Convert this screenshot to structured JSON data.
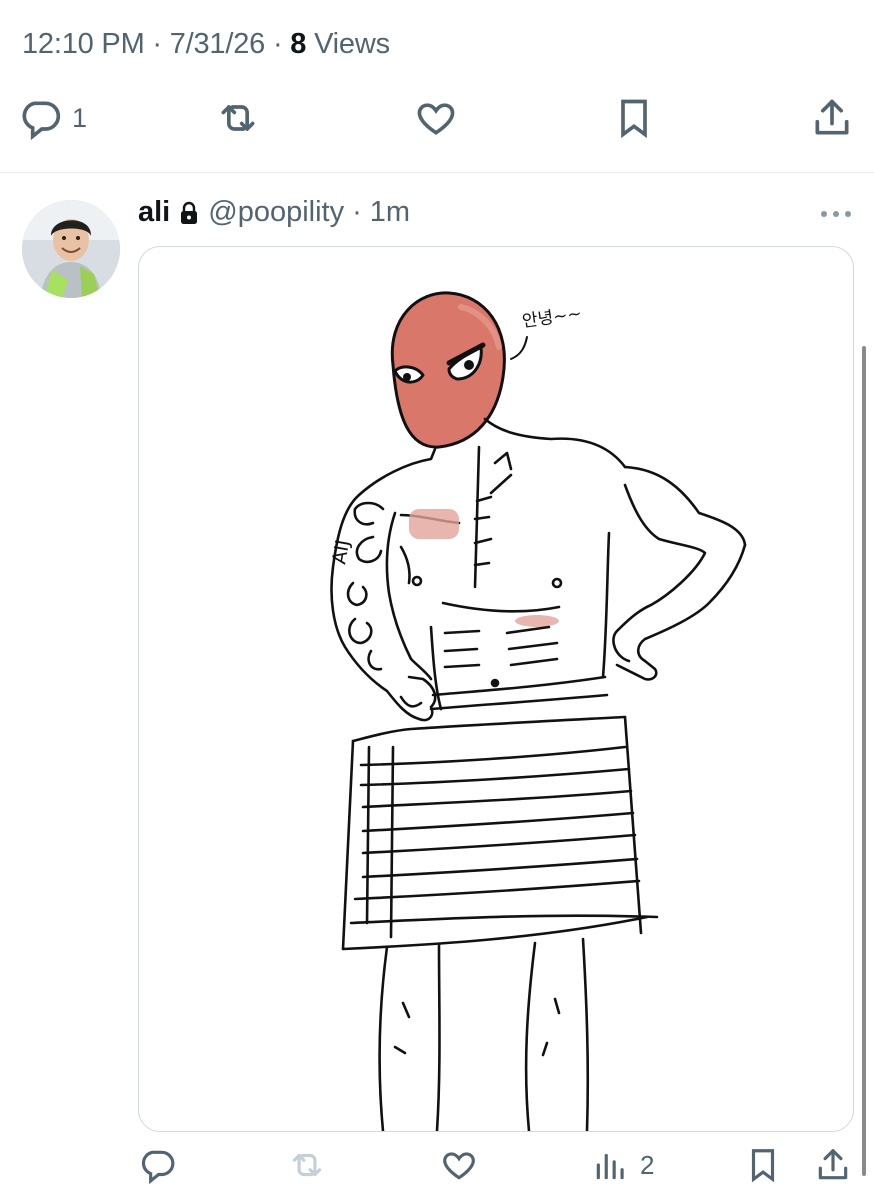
{
  "tweet": {
    "time": "12:10 PM",
    "date": "7/31/26",
    "views_count": "8",
    "views_label": "Views",
    "separator": "·"
  },
  "actions": {
    "reply_count": "1"
  },
  "reply": {
    "display_name": "ali",
    "handle": "@poopility",
    "age": "1m",
    "drawing_speech": "안녕~~",
    "tattoo_text": "AIJ",
    "views_count": "2"
  },
  "icons": {
    "reply": "reply-icon",
    "retweet": "retweet-icon",
    "like": "heart-icon",
    "bookmark": "bookmark-icon",
    "share": "share-icon",
    "lock": "lock-icon",
    "more": "more-icon",
    "views": "analytics-icon"
  },
  "colors": {
    "text_secondary": "#536471",
    "mask": "#d9786a",
    "blush": "#e4a29b"
  }
}
